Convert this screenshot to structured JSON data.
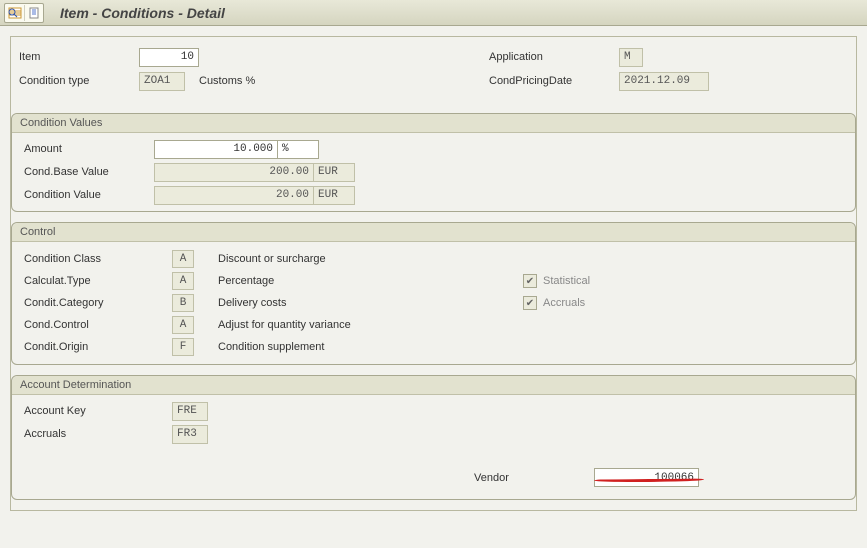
{
  "window": {
    "title": "Item - Conditions - Detail"
  },
  "header": {
    "item_label": "Item",
    "item_value": "10",
    "cond_type_label": "Condition type",
    "cond_type_value": "ZOA1",
    "cond_type_desc": "Customs %",
    "application_label": "Application",
    "application_value": "M",
    "pricing_date_label": "CondPricingDate",
    "pricing_date_value": "2021.12.09"
  },
  "condition_values": {
    "title": "Condition Values",
    "amount_label": "Amount",
    "amount_value": "10.000",
    "amount_unit": "%",
    "base_label": "Cond.Base Value",
    "base_value": "200.00",
    "base_unit": "EUR",
    "cond_value_label": "Condition Value",
    "cond_value_value": "20.00",
    "cond_value_unit": "EUR"
  },
  "control": {
    "title": "Control",
    "rows": [
      {
        "label": "Condition Class",
        "code": "A",
        "desc": "Discount or surcharge"
      },
      {
        "label": "Calculat.Type",
        "code": "A",
        "desc": "Percentage"
      },
      {
        "label": "Condit.Category",
        "code": "B",
        "desc": "Delivery costs"
      },
      {
        "label": "Cond.Control",
        "code": "A",
        "desc": "Adjust for quantity variance"
      },
      {
        "label": "Condit.Origin",
        "code": "F",
        "desc": "Condition supplement"
      }
    ],
    "statistical_label": "Statistical",
    "accruals_label": "Accruals"
  },
  "account": {
    "title": "Account Determination",
    "account_key_label": "Account Key",
    "account_key_value": "FRE",
    "accruals_label": "Accruals",
    "accruals_value": "FR3",
    "vendor_label": "Vendor",
    "vendor_value": "100066"
  }
}
